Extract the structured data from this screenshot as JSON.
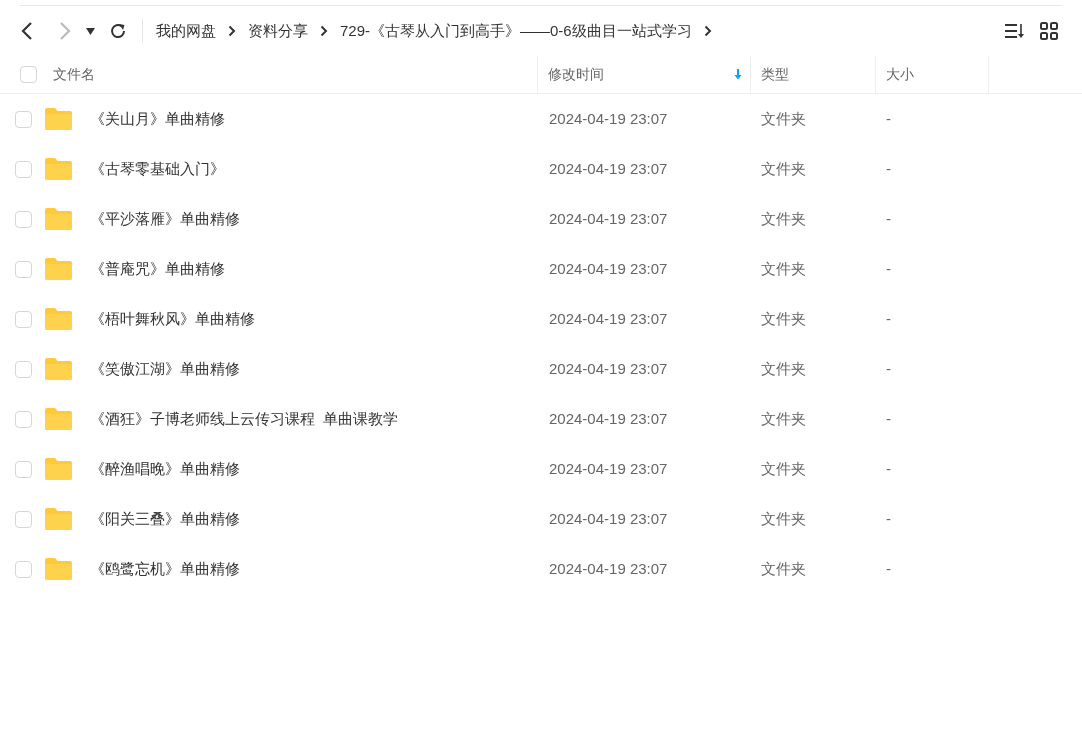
{
  "nav": {
    "back_disabled": false,
    "forward_disabled": true
  },
  "breadcrumb": [
    "我的网盘",
    "资料分享",
    "729-《古琴从入门到高手》——0-6级曲目一站式学习"
  ],
  "table": {
    "select_all_checked": false,
    "columns": [
      {
        "label": "文件名",
        "sorted": false
      },
      {
        "label": "修改时间",
        "sorted": true
      },
      {
        "label": "类型",
        "sorted": false
      },
      {
        "label": "大小",
        "sorted": false
      }
    ],
    "rows": [
      {
        "name": "《关山月》单曲精修",
        "modified": "2024-04-19 23:07",
        "type": "文件夹",
        "size": "-",
        "checked": false
      },
      {
        "name": "《古琴零基础入门》",
        "modified": "2024-04-19 23:07",
        "type": "文件夹",
        "size": "-",
        "checked": false
      },
      {
        "name": "《平沙落雁》单曲精修",
        "modified": "2024-04-19 23:07",
        "type": "文件夹",
        "size": "-",
        "checked": false
      },
      {
        "name": "《普庵咒》单曲精修",
        "modified": "2024-04-19 23:07",
        "type": "文件夹",
        "size": "-",
        "checked": false
      },
      {
        "name": "《梧叶舞秋风》单曲精修",
        "modified": "2024-04-19 23:07",
        "type": "文件夹",
        "size": "-",
        "checked": false
      },
      {
        "name": "《笑傲江湖》单曲精修",
        "modified": "2024-04-19 23:07",
        "type": "文件夹",
        "size": "-",
        "checked": false
      },
      {
        "name": "《酒狂》子博老师线上云传习课程  单曲课教学",
        "modified": "2024-04-19 23:07",
        "type": "文件夹",
        "size": "-",
        "checked": false
      },
      {
        "name": "《醉渔唱晚》单曲精修",
        "modified": "2024-04-19 23:07",
        "type": "文件夹",
        "size": "-",
        "checked": false
      },
      {
        "name": "《阳关三叠》单曲精修",
        "modified": "2024-04-19 23:07",
        "type": "文件夹",
        "size": "-",
        "checked": false
      },
      {
        "name": "《鸥鹭忘机》单曲精修",
        "modified": "2024-04-19 23:07",
        "type": "文件夹",
        "size": "-",
        "checked": false
      }
    ]
  }
}
